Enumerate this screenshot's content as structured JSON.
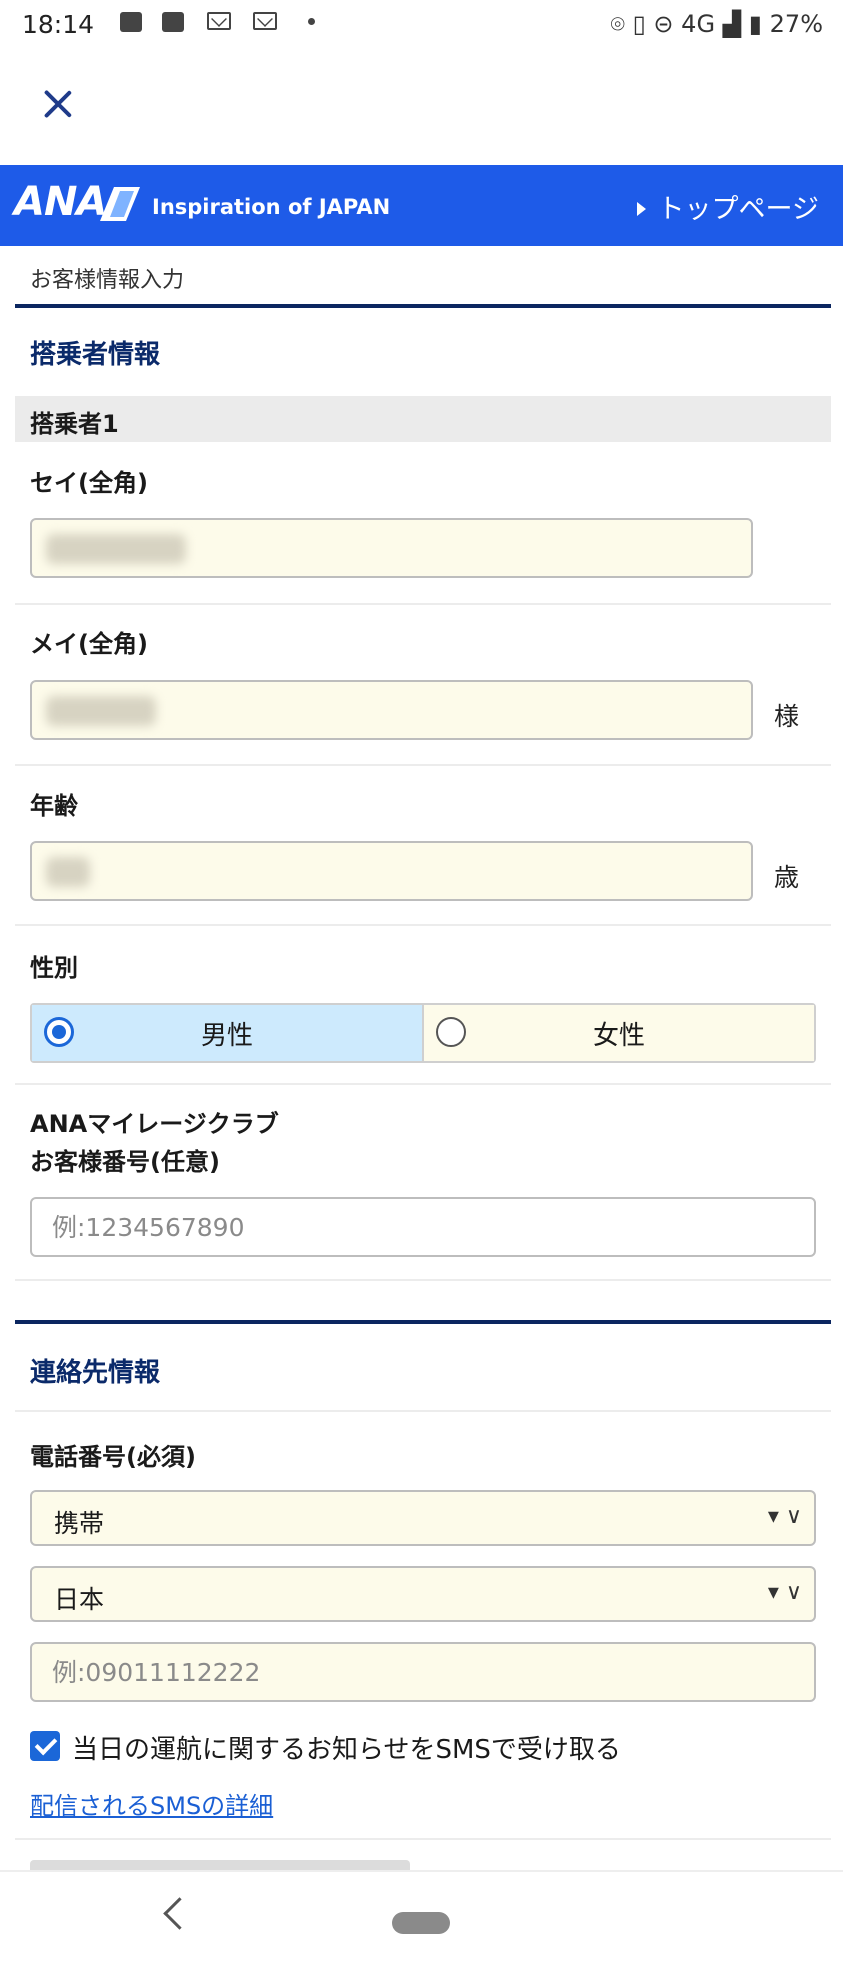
{
  "status_bar": {
    "time": "18:14",
    "right_text": "4G",
    "battery": "27%",
    "icons": [
      "image-icon",
      "news-icon",
      "mail-icon",
      "mail-icon",
      "dot-icon",
      "location-icon",
      "vibrate-icon",
      "dnd-icon",
      "signal-icon",
      "battery-icon"
    ]
  },
  "header": {
    "logo": "ANA",
    "tagline": "Inspiration of JAPAN",
    "top_link": "トップページ",
    "color": "#1e5be8"
  },
  "breadcrumb": "お客様情報入力",
  "passenger_section": {
    "title": "搭乗者情報",
    "subheading": "搭乗者1",
    "sei_label": "セイ(全角)",
    "mei_label": "メイ(全角)",
    "mei_suffix": "様",
    "age_label": "年齢",
    "age_suffix": "歳",
    "gender_label": "性別",
    "gender_options": [
      {
        "label": "男性",
        "selected": true
      },
      {
        "label": "女性",
        "selected": false
      }
    ],
    "mileage_label_1": "ANAマイレージクラブ",
    "mileage_label_2": "お客様番号(任意)",
    "mileage_placeholder": "例:1234567890"
  },
  "contact_section": {
    "title": "連絡先情報",
    "phone_label": "電話番号(必須)",
    "phone_type": "携帯",
    "country": "日本",
    "phone_placeholder": "例:09011112222",
    "sms_checkbox_label": "当日の運航に関するお知らせをSMSで受け取る",
    "sms_checked": true,
    "sms_details_link": "配信されるSMSの詳細"
  }
}
